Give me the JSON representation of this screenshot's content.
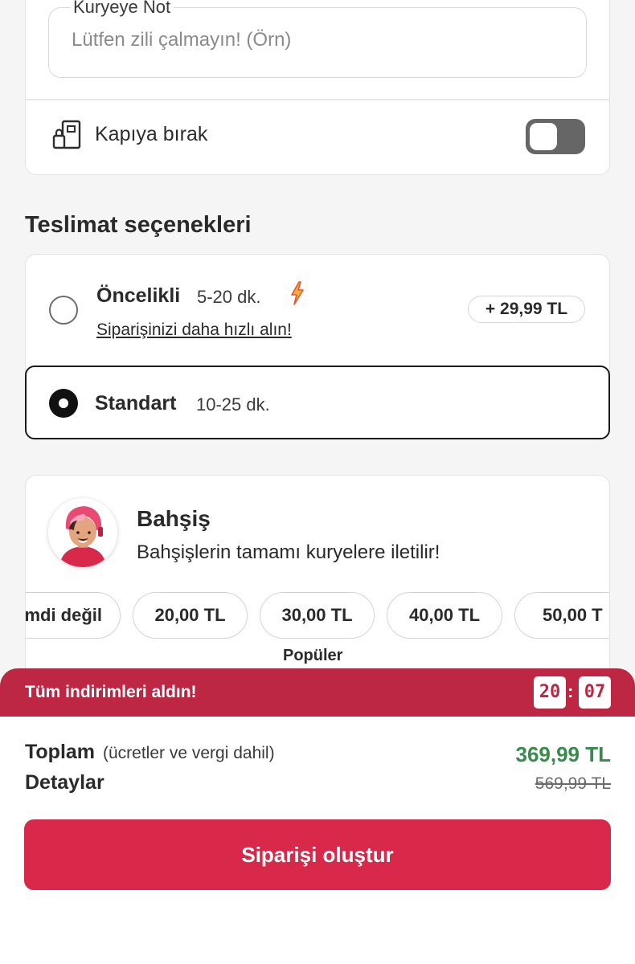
{
  "courier_note": {
    "label": "Kuryeye Not",
    "placeholder": "Lütfen zili çalmayın! (Örn)",
    "leave_at_door_label": "Kapıya bırak",
    "leave_at_door_enabled": false
  },
  "delivery": {
    "title": "Teslimat seçenekleri",
    "options": [
      {
        "name": "Öncelikli",
        "time": "5-20 dk.",
        "subtitle": "Siparişinizi daha hızlı alın!",
        "price": "+ 29,99 TL",
        "selected": false,
        "icon": "lightning-icon"
      },
      {
        "name": "Standart",
        "time": "10-25 dk.",
        "selected": true
      }
    ]
  },
  "tip": {
    "title": "Bahşiş",
    "subtitle": "Bahşişlerin tamamı kuryelere iletilir!",
    "options": [
      "mdi değil",
      "20,00 TL",
      "30,00 TL",
      "40,00 TL",
      "50,00 T"
    ],
    "popular_label": "Popüler"
  },
  "banner": {
    "text": "Tüm indirimleri aldın!",
    "timer_minutes": "20",
    "timer_seconds": "07",
    "color": "#bd2744"
  },
  "summary": {
    "total_label": "Toplam",
    "total_note": "(ücretler ve vergi dahil)",
    "details_label": "Detaylar",
    "total_price": "369,99 TL",
    "old_price": "569,99 TL",
    "total_price_color": "#3a8a4e"
  },
  "cta": {
    "label": "Siparişi oluştur",
    "color": "#d8294b"
  }
}
